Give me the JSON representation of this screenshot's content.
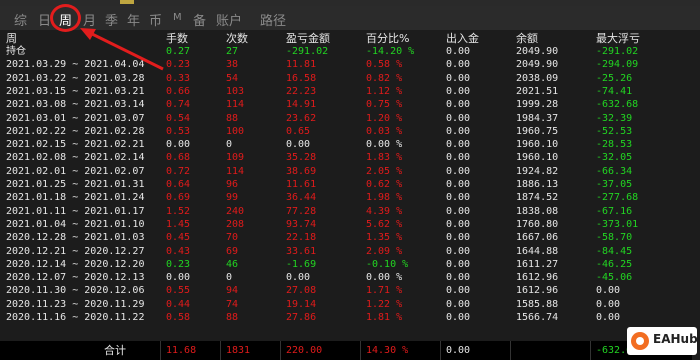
{
  "tabs": [
    {
      "label": "综",
      "active": false
    },
    {
      "label": "日",
      "active": false
    },
    {
      "label": "周",
      "active": true
    },
    {
      "label": "月",
      "active": false
    },
    {
      "label": "季",
      "active": false
    },
    {
      "label": "年",
      "active": false
    },
    {
      "label": "币",
      "active": false
    },
    {
      "label": "M",
      "active": false
    },
    {
      "label": "备",
      "active": false
    },
    {
      "label": "账户",
      "active": false
    },
    {
      "label": "路径",
      "active": false
    }
  ],
  "colors": {
    "profit": "#22d422",
    "loss": "#e01b1b",
    "annotation": "#e21d1d"
  },
  "table": {
    "headers": [
      "周",
      "手数",
      "次数",
      "盈亏金额",
      "百分比%",
      "出入金",
      "余额",
      "最大浮亏"
    ],
    "rows": [
      {
        "period": "持仓",
        "lots": "0.27",
        "trades": "27",
        "pnl": "-291.02",
        "pct": "-14.20 %",
        "flow": "0.00",
        "balance": "2049.90",
        "maxdd": "-291.02",
        "color": "grn",
        "ddcolor": "grn"
      },
      {
        "period": "2021.03.29 ~ 2021.04.04",
        "lots": "0.23",
        "trades": "38",
        "pnl": "11.81",
        "pct": "0.58 %",
        "flow": "0.00",
        "balance": "2049.90",
        "maxdd": "-294.09",
        "color": "red",
        "ddcolor": "grn"
      },
      {
        "period": "2021.03.22 ~ 2021.03.28",
        "lots": "0.33",
        "trades": "54",
        "pnl": "16.58",
        "pct": "0.82 %",
        "flow": "0.00",
        "balance": "2038.09",
        "maxdd": "-25.26",
        "color": "red",
        "ddcolor": "grn"
      },
      {
        "period": "2021.03.15 ~ 2021.03.21",
        "lots": "0.66",
        "trades": "103",
        "pnl": "22.23",
        "pct": "1.12 %",
        "flow": "0.00",
        "balance": "2021.51",
        "maxdd": "-74.41",
        "color": "red",
        "ddcolor": "grn"
      },
      {
        "period": "2021.03.08 ~ 2021.03.14",
        "lots": "0.74",
        "trades": "114",
        "pnl": "14.91",
        "pct": "0.75 %",
        "flow": "0.00",
        "balance": "1999.28",
        "maxdd": "-632.68",
        "color": "red",
        "ddcolor": "grn"
      },
      {
        "period": "2021.03.01 ~ 2021.03.07",
        "lots": "0.54",
        "trades": "88",
        "pnl": "23.62",
        "pct": "1.20 %",
        "flow": "0.00",
        "balance": "1984.37",
        "maxdd": "-32.39",
        "color": "red",
        "ddcolor": "grn"
      },
      {
        "period": "2021.02.22 ~ 2021.02.28",
        "lots": "0.53",
        "trades": "100",
        "pnl": "0.65",
        "pct": "0.03 %",
        "flow": "0.00",
        "balance": "1960.75",
        "maxdd": "-52.53",
        "color": "red",
        "ddcolor": "grn"
      },
      {
        "period": "2021.02.15 ~ 2021.02.21",
        "lots": "0.00",
        "trades": "0",
        "pnl": "0.00",
        "pct": "0.00 %",
        "flow": "0.00",
        "balance": "1960.10",
        "maxdd": "-28.53",
        "color": "wht",
        "ddcolor": "grn"
      },
      {
        "period": "2021.02.08 ~ 2021.02.14",
        "lots": "0.68",
        "trades": "109",
        "pnl": "35.28",
        "pct": "1.83 %",
        "flow": "0.00",
        "balance": "1960.10",
        "maxdd": "-32.05",
        "color": "red",
        "ddcolor": "grn"
      },
      {
        "period": "2021.02.01 ~ 2021.02.07",
        "lots": "0.72",
        "trades": "114",
        "pnl": "38.69",
        "pct": "2.05 %",
        "flow": "0.00",
        "balance": "1924.82",
        "maxdd": "-66.34",
        "color": "red",
        "ddcolor": "grn"
      },
      {
        "period": "2021.01.25 ~ 2021.01.31",
        "lots": "0.64",
        "trades": "96",
        "pnl": "11.61",
        "pct": "0.62 %",
        "flow": "0.00",
        "balance": "1886.13",
        "maxdd": "-37.05",
        "color": "red",
        "ddcolor": "grn"
      },
      {
        "period": "2021.01.18 ~ 2021.01.24",
        "lots": "0.69",
        "trades": "99",
        "pnl": "36.44",
        "pct": "1.98 %",
        "flow": "0.00",
        "balance": "1874.52",
        "maxdd": "-277.68",
        "color": "red",
        "ddcolor": "grn"
      },
      {
        "period": "2021.01.11 ~ 2021.01.17",
        "lots": "1.52",
        "trades": "240",
        "pnl": "77.28",
        "pct": "4.39 %",
        "flow": "0.00",
        "balance": "1838.08",
        "maxdd": "-67.16",
        "color": "red",
        "ddcolor": "grn"
      },
      {
        "period": "2021.01.04 ~ 2021.01.10",
        "lots": "1.45",
        "trades": "208",
        "pnl": "93.74",
        "pct": "5.62 %",
        "flow": "0.00",
        "balance": "1760.80",
        "maxdd": "-373.01",
        "color": "red",
        "ddcolor": "grn"
      },
      {
        "period": "2020.12.28 ~ 2021.01.03",
        "lots": "0.45",
        "trades": "70",
        "pnl": "22.18",
        "pct": "1.35 %",
        "flow": "0.00",
        "balance": "1667.06",
        "maxdd": "-58.70",
        "color": "red",
        "ddcolor": "grn"
      },
      {
        "period": "2020.12.21 ~ 2020.12.27",
        "lots": "0.43",
        "trades": "69",
        "pnl": "33.61",
        "pct": "2.09 %",
        "flow": "0.00",
        "balance": "1644.88",
        "maxdd": "-84.45",
        "color": "red",
        "ddcolor": "grn"
      },
      {
        "period": "2020.12.14 ~ 2020.12.20",
        "lots": "0.23",
        "trades": "46",
        "pnl": "-1.69",
        "pct": "-0.10 %",
        "flow": "0.00",
        "balance": "1611.27",
        "maxdd": "-46.25",
        "color": "grn",
        "ddcolor": "grn"
      },
      {
        "period": "2020.12.07 ~ 2020.12.13",
        "lots": "0.00",
        "trades": "0",
        "pnl": "0.00",
        "pct": "0.00 %",
        "flow": "0.00",
        "balance": "1612.96",
        "maxdd": "-45.06",
        "color": "wht",
        "ddcolor": "grn"
      },
      {
        "period": "2020.11.30 ~ 2020.12.06",
        "lots": "0.55",
        "trades": "94",
        "pnl": "27.08",
        "pct": "1.71 %",
        "flow": "0.00",
        "balance": "1612.96",
        "maxdd": "0.00",
        "color": "red",
        "ddcolor": "wht"
      },
      {
        "period": "2020.11.23 ~ 2020.11.29",
        "lots": "0.44",
        "trades": "74",
        "pnl": "19.14",
        "pct": "1.22 %",
        "flow": "0.00",
        "balance": "1585.88",
        "maxdd": "0.00",
        "color": "red",
        "ddcolor": "wht"
      },
      {
        "period": "2020.11.16 ~ 2020.11.22",
        "lots": "0.58",
        "trades": "88",
        "pnl": "27.86",
        "pct": "1.81 %",
        "flow": "0.00",
        "balance": "1566.74",
        "maxdd": "0.00",
        "color": "red",
        "ddcolor": "wht"
      }
    ],
    "total": {
      "label": "合计",
      "lots": "11.68",
      "trades": "1831",
      "pnl": "220.00",
      "pct": "14.30 %",
      "flow": "0.00",
      "balance": "",
      "maxdd": "-632.68"
    }
  },
  "watermark": {
    "text": "EAHub"
  }
}
